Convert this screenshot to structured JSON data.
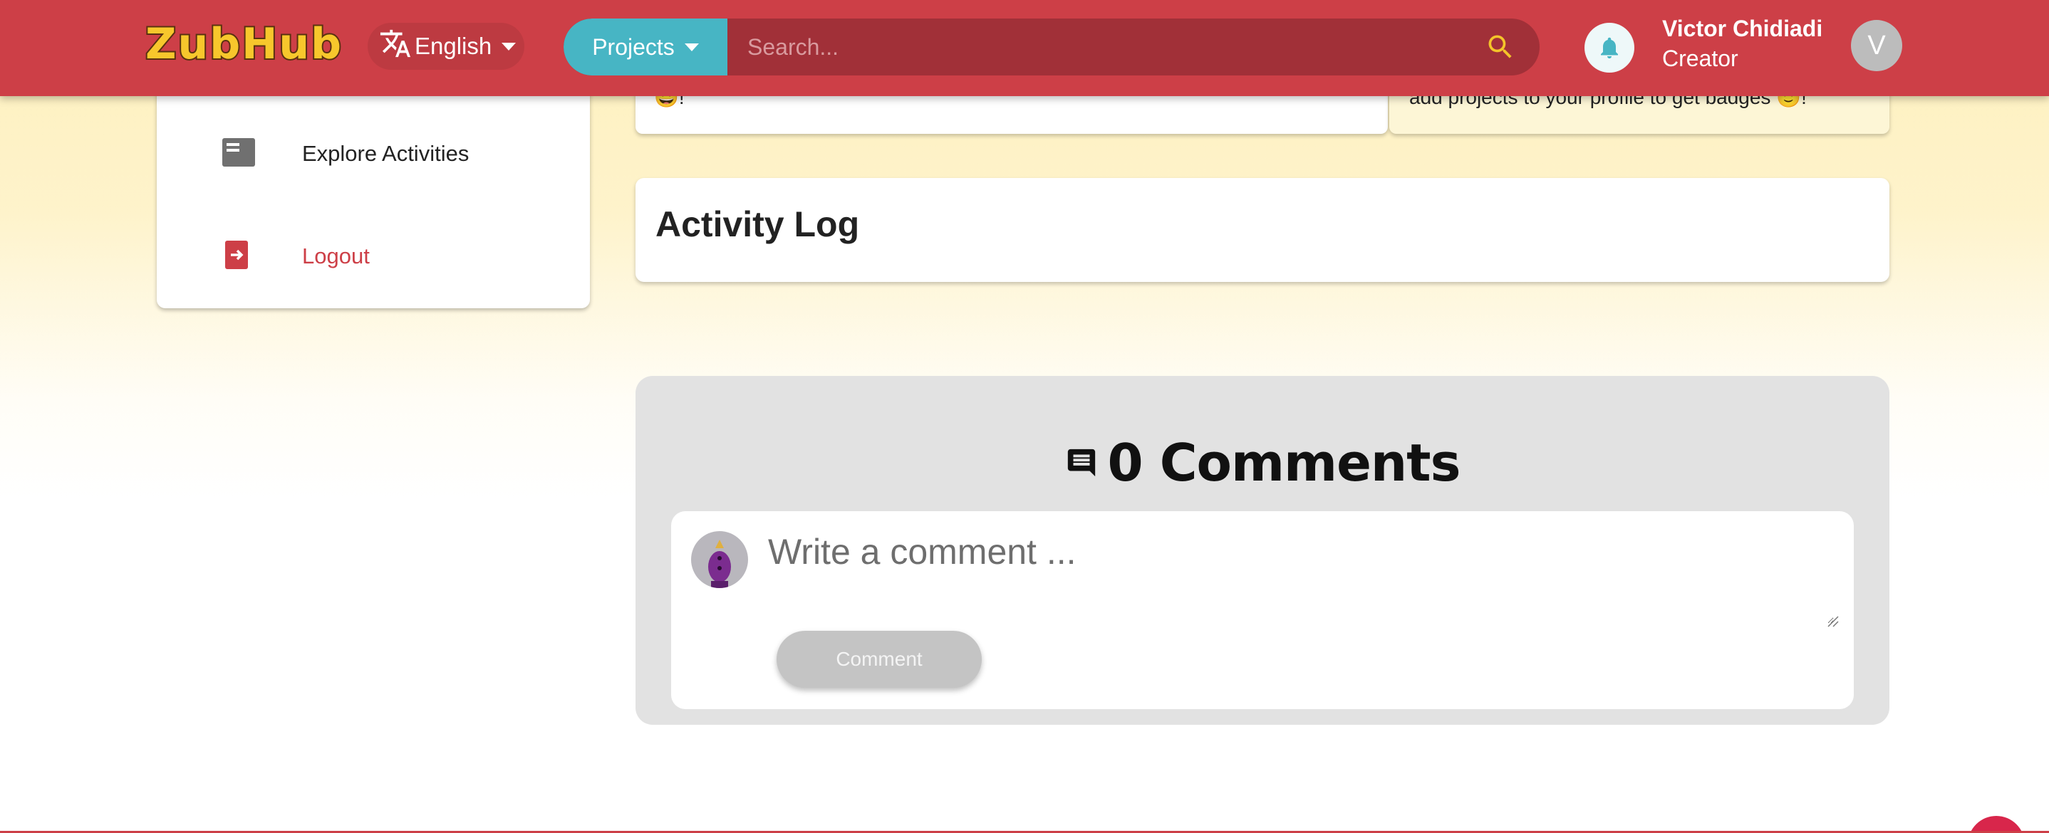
{
  "app": {
    "logo_text": "ZubHub"
  },
  "header": {
    "language": "English",
    "search_category": "Projects",
    "search_placeholder": "Search...",
    "user_name": "Victor Chidiadi",
    "user_role": "Creator",
    "user_initial": "V"
  },
  "sidebar": {
    "items": [
      {
        "label": "Explore Activities",
        "icon": "activities-icon"
      },
      {
        "label": "Logout",
        "icon": "logout-icon"
      }
    ]
  },
  "cards": {
    "top_left_text": "😀!",
    "top_right_text": "add projects to your profile to get badges 🙂!",
    "activity_title": "Activity Log"
  },
  "comments": {
    "count_label": "0 Comments",
    "placeholder": "Write a comment ...",
    "submit_label": "Comment"
  },
  "colors": {
    "brand_red": "#cd3f47",
    "accent_teal": "#47b5c4",
    "logo_yellow": "#f7c72c"
  }
}
